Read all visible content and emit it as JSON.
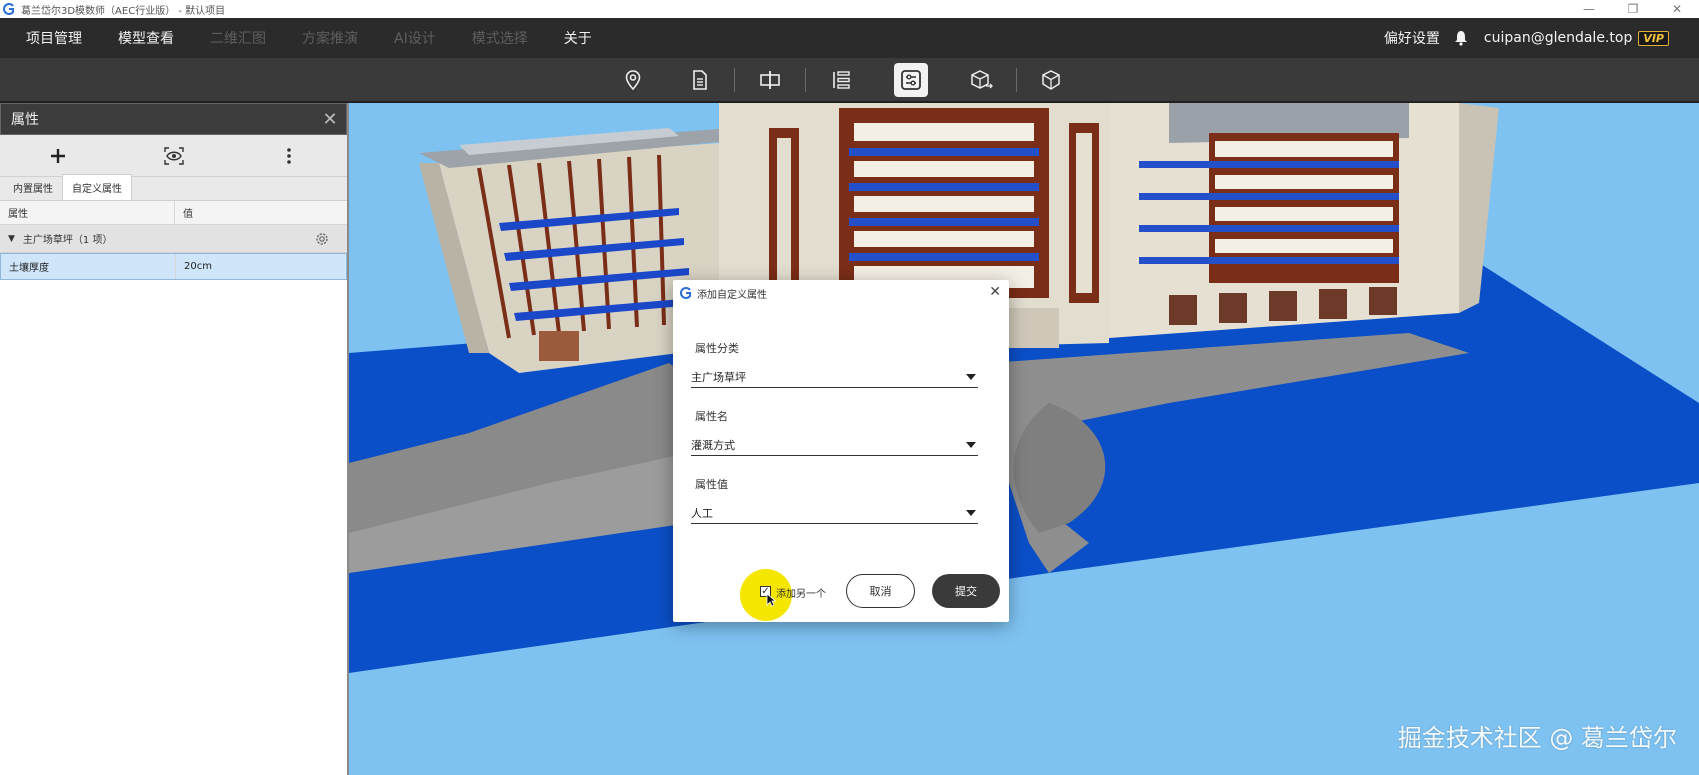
{
  "window": {
    "title": "葛兰岱尔3D模数师（AEC行业版） - 默认项目",
    "minimize": "—",
    "restore": "❐",
    "close": "✕"
  },
  "menu": {
    "items": [
      {
        "label": "项目管理",
        "enabled": true
      },
      {
        "label": "模型查看",
        "enabled": true
      },
      {
        "label": "二维汇图",
        "enabled": false
      },
      {
        "label": "方案推演",
        "enabled": false
      },
      {
        "label": "AI设计",
        "enabled": false
      },
      {
        "label": "模式选择",
        "enabled": false
      },
      {
        "label": "关于",
        "enabled": true
      }
    ],
    "preferences": "偏好设置",
    "user": "cuipan@glendale.top",
    "vip": "VIP"
  },
  "toolbar": {
    "tools": [
      {
        "icon": "location-pin-icon"
      },
      {
        "icon": "document-icon"
      },
      {
        "icon": "split-view-icon"
      },
      {
        "icon": "tree-list-icon"
      },
      {
        "icon": "properties-icon",
        "active": true
      },
      {
        "icon": "export-model-icon"
      },
      {
        "icon": "cube-icon"
      }
    ]
  },
  "panel": {
    "title": "属性",
    "close": "✕",
    "tabs": [
      {
        "label": "内置属性",
        "active": false
      },
      {
        "label": "自定义属性",
        "active": true
      }
    ],
    "columns": {
      "name": "属性",
      "value": "值"
    },
    "group": {
      "label": "主广场草坪（1 项）"
    },
    "rows": [
      {
        "name": "土壤厚度",
        "value": "20cm"
      }
    ]
  },
  "dialog": {
    "title": "添加自定义属性",
    "close": "✕",
    "fields": [
      {
        "label": "属性分类",
        "value": "主广场草坪"
      },
      {
        "label": "属性名",
        "value": "灌溉方式"
      },
      {
        "label": "属性值",
        "value": "人工"
      }
    ],
    "add_another": {
      "label": "添加另一个",
      "checked": true,
      "check_mark": "✓"
    },
    "cancel": "取消",
    "submit": "提交"
  },
  "watermark": "掘金技术社区 @ 葛兰岱尔",
  "colors": {
    "menubar": "#2b2b2b",
    "toolbar": "#3a3a3a",
    "sky": "#7ec2f2",
    "water": "#0b4fc8",
    "highlight": "#cfe6fa",
    "cursor_spot": "#f5e600"
  }
}
